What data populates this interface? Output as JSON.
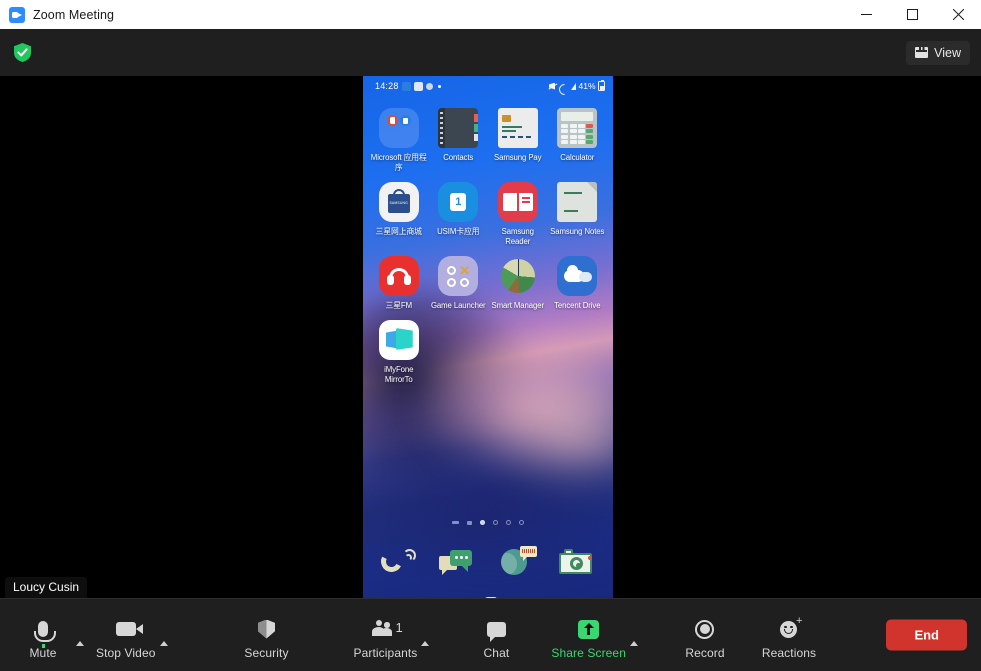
{
  "window": {
    "title": "Zoom Meeting",
    "logo_icon": "zoom-camera-icon",
    "minimize_label": "Minimize",
    "maximize_label": "Maximize",
    "close_label": "Close"
  },
  "meeting_header": {
    "encryption_icon": "green-shield-check-icon",
    "view_label": "View",
    "view_icon": "grid-view-icon"
  },
  "stage": {
    "name_tag": "Loucy Cusin"
  },
  "phone": {
    "status_bar": {
      "time": "14:28",
      "battery_percent": "41%",
      "icons_left": [
        "app-badge-icon",
        "taobao-icon",
        "app-icon",
        "dot-icon"
      ],
      "icons_right": [
        "mute-icon",
        "wifi-icon",
        "signal-icon",
        "battery-icon"
      ]
    },
    "rows": [
      [
        {
          "label": "Microsoft 应用程序",
          "icon": "microsoft-folder-icon",
          "art": "ic-msfolder"
        },
        {
          "label": "Contacts",
          "icon": "contacts-icon",
          "art": "ic-contacts"
        },
        {
          "label": "Samsung Pay",
          "icon": "samsung-pay-icon",
          "art": "ic-pay"
        },
        {
          "label": "Calculator",
          "icon": "calculator-icon",
          "art": "ic-calc"
        }
      ],
      [
        {
          "label": "三星网上商城",
          "icon": "samsung-store-icon",
          "art": "ic-store"
        },
        {
          "label": "USIM卡应用",
          "icon": "usim-card-icon",
          "art": "ic-usim"
        },
        {
          "label": "Samsung Reader",
          "icon": "samsung-reader-icon",
          "art": "ic-reader"
        },
        {
          "label": "Samsung Notes",
          "icon": "samsung-notes-icon",
          "art": "ic-notes"
        }
      ],
      [
        {
          "label": "三星FM",
          "icon": "samsung-fm-icon",
          "art": "ic-fm"
        },
        {
          "label": "Game Launcher",
          "icon": "game-launcher-icon",
          "art": "ic-game"
        },
        {
          "label": "Smart Manager",
          "icon": "smart-manager-icon",
          "art": "ic-smart"
        },
        {
          "label": "Tencent Drive",
          "icon": "tencent-drive-icon",
          "art": "ic-tencent"
        }
      ],
      [
        {
          "label": "iMyFone MirrorTo",
          "icon": "imyfone-mirrorto-icon",
          "art": "ic-mirror"
        }
      ]
    ],
    "page_dots": {
      "count": 6,
      "active_index": 2
    },
    "dock": [
      {
        "icon": "phone-dialer-icon",
        "art": "d-phone"
      },
      {
        "icon": "messages-icon",
        "art": "d-msg"
      },
      {
        "icon": "browser-icon",
        "art": "d-net"
      },
      {
        "icon": "camera-icon",
        "art": "d-cam"
      }
    ],
    "nav_bar": [
      {
        "icon": "recents-icon",
        "art": "nav-recents"
      },
      {
        "icon": "home-icon",
        "art": "nav-home"
      },
      {
        "icon": "back-icon",
        "art": "nav-back"
      }
    ]
  },
  "toolbar": {
    "mute_label": "Mute",
    "stop_video_label": "Stop Video",
    "security_label": "Security",
    "participants_label": "Participants",
    "participants_count": "1",
    "chat_label": "Chat",
    "share_screen_label": "Share Screen",
    "record_label": "Record",
    "reactions_label": "Reactions",
    "end_label": "End",
    "accent_green": "#3bd671",
    "end_red": "#d0342c"
  }
}
